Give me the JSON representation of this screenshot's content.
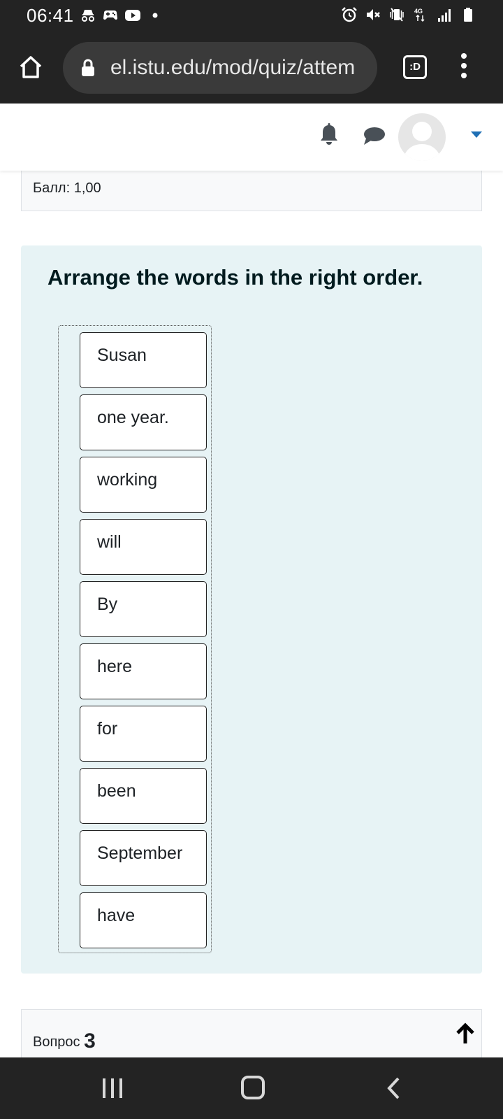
{
  "status_bar": {
    "time": "06:41",
    "left_icons": [
      "incognito-icon",
      "game-controller-icon",
      "youtube-icon",
      "dot-icon"
    ],
    "right_icons": [
      "alarm-icon",
      "mute-icon",
      "vibrate-icon",
      "network-4g-icon",
      "signal-icon",
      "battery-icon"
    ],
    "network_label": "4G"
  },
  "browser": {
    "url": "el.istu.edu/mod/quiz/attem",
    "tab_label": ":D"
  },
  "header": {
    "icons": [
      "bell-icon",
      "chat-icon",
      "avatar",
      "caret-down-icon"
    ],
    "accent_color": "#1f6fb5"
  },
  "previous_question": {
    "score_label": "Балл: 1,00"
  },
  "question": {
    "text": "Arrange the words in the right order.",
    "background_color": "#e7f3f5",
    "items": [
      {
        "label": "Susan"
      },
      {
        "label": "one year."
      },
      {
        "label": "working"
      },
      {
        "label": "will"
      },
      {
        "label": "By"
      },
      {
        "label": "here"
      },
      {
        "label": "for"
      },
      {
        "label": "been"
      },
      {
        "label": "September"
      },
      {
        "label": "have"
      }
    ]
  },
  "next_question": {
    "label": "Вопрос",
    "number": "3"
  },
  "nav_bar": {
    "buttons": [
      "recent-apps-button",
      "home-button",
      "back-button"
    ]
  }
}
